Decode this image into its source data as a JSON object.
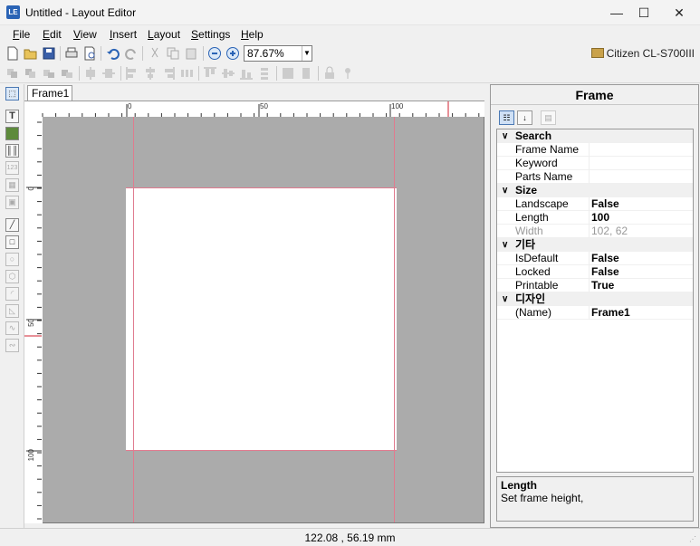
{
  "window": {
    "title": "Untitled - Layout Editor",
    "app_icon": "layout-editor-icon",
    "minimize": "—",
    "maximize": "☐",
    "close": "✕"
  },
  "menu": [
    {
      "label": "File",
      "key": "F",
      "rest": "ile"
    },
    {
      "label": "Edit",
      "key": "E",
      "rest": "dit"
    },
    {
      "label": "View",
      "key": "V",
      "rest": "iew"
    },
    {
      "label": "Insert",
      "key": "I",
      "rest": "nsert"
    },
    {
      "label": "Layout",
      "key": "L",
      "rest": "ayout"
    },
    {
      "label": "Settings",
      "key": "S",
      "rest": "ettings"
    },
    {
      "label": "Help",
      "key": "H",
      "rest": "elp"
    }
  ],
  "toolbar": {
    "zoom": "87.67%",
    "printer": "Citizen CL-S700III"
  },
  "document": {
    "tab": "Frame1",
    "ruler_h": [
      "0",
      "50",
      "100"
    ],
    "ruler_v": [
      "0",
      "50",
      "100"
    ]
  },
  "properties": {
    "title": "Frame",
    "categories": [
      {
        "name": "Search",
        "rows": [
          {
            "name": "Frame Name",
            "value": ""
          },
          {
            "name": "Keyword",
            "value": ""
          },
          {
            "name": "Parts Name",
            "value": ""
          }
        ]
      },
      {
        "name": "Size",
        "rows": [
          {
            "name": "Landscape",
            "value": "False"
          },
          {
            "name": "Length",
            "value": "100"
          },
          {
            "name": "Width",
            "value": "102, 62"
          }
        ]
      },
      {
        "name": "기타",
        "rows": [
          {
            "name": "IsDefault",
            "value": "False"
          },
          {
            "name": "Locked",
            "value": "False"
          },
          {
            "name": "Printable",
            "value": "True"
          }
        ]
      },
      {
        "name": "디자인",
        "rows": [
          {
            "name": "(Name)",
            "value": "Frame1"
          }
        ]
      }
    ],
    "description": {
      "title": "Length",
      "text": "Set frame height,"
    }
  },
  "status": {
    "coords": "122.08 , 56.19 mm"
  },
  "colors": {
    "canvas": "#ababab",
    "guide": "#e07b8f",
    "accent": "#2a63b5"
  }
}
